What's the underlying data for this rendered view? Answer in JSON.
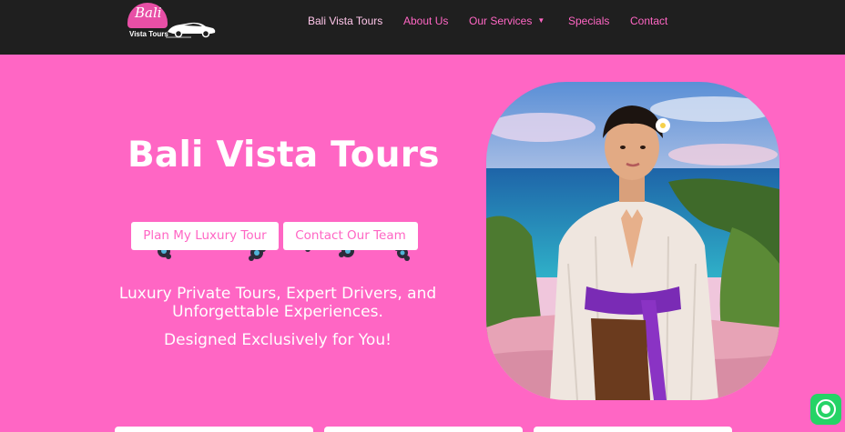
{
  "logo": {
    "title": "Bali",
    "subtitle": "Vista Tours"
  },
  "nav": {
    "items": [
      {
        "label": "Bali Vista Tours",
        "active": true
      },
      {
        "label": "About Us"
      },
      {
        "label": "Our Services",
        "has_dropdown": true
      },
      {
        "label": "Specials"
      },
      {
        "label": "Contact"
      }
    ]
  },
  "hero": {
    "title": "Bali Vista Tours",
    "buttons": {
      "primary": "Plan My Luxury Tour",
      "secondary": "Contact Our Team"
    },
    "tagline_line1": "Luxury Private Tours, Expert Drivers, and",
    "tagline_line2": "Unforgettable Experiences.",
    "tagline_sub": "Designed Exclusively for You!"
  },
  "colors": {
    "brand_pink": "#ff66c4",
    "header_bg": "#1f1f1f",
    "whatsapp_green": "#25d366"
  },
  "icons": {
    "whatsapp": "whatsapp-icon",
    "chevron": "chevron-down-icon",
    "car": "car-icon"
  }
}
